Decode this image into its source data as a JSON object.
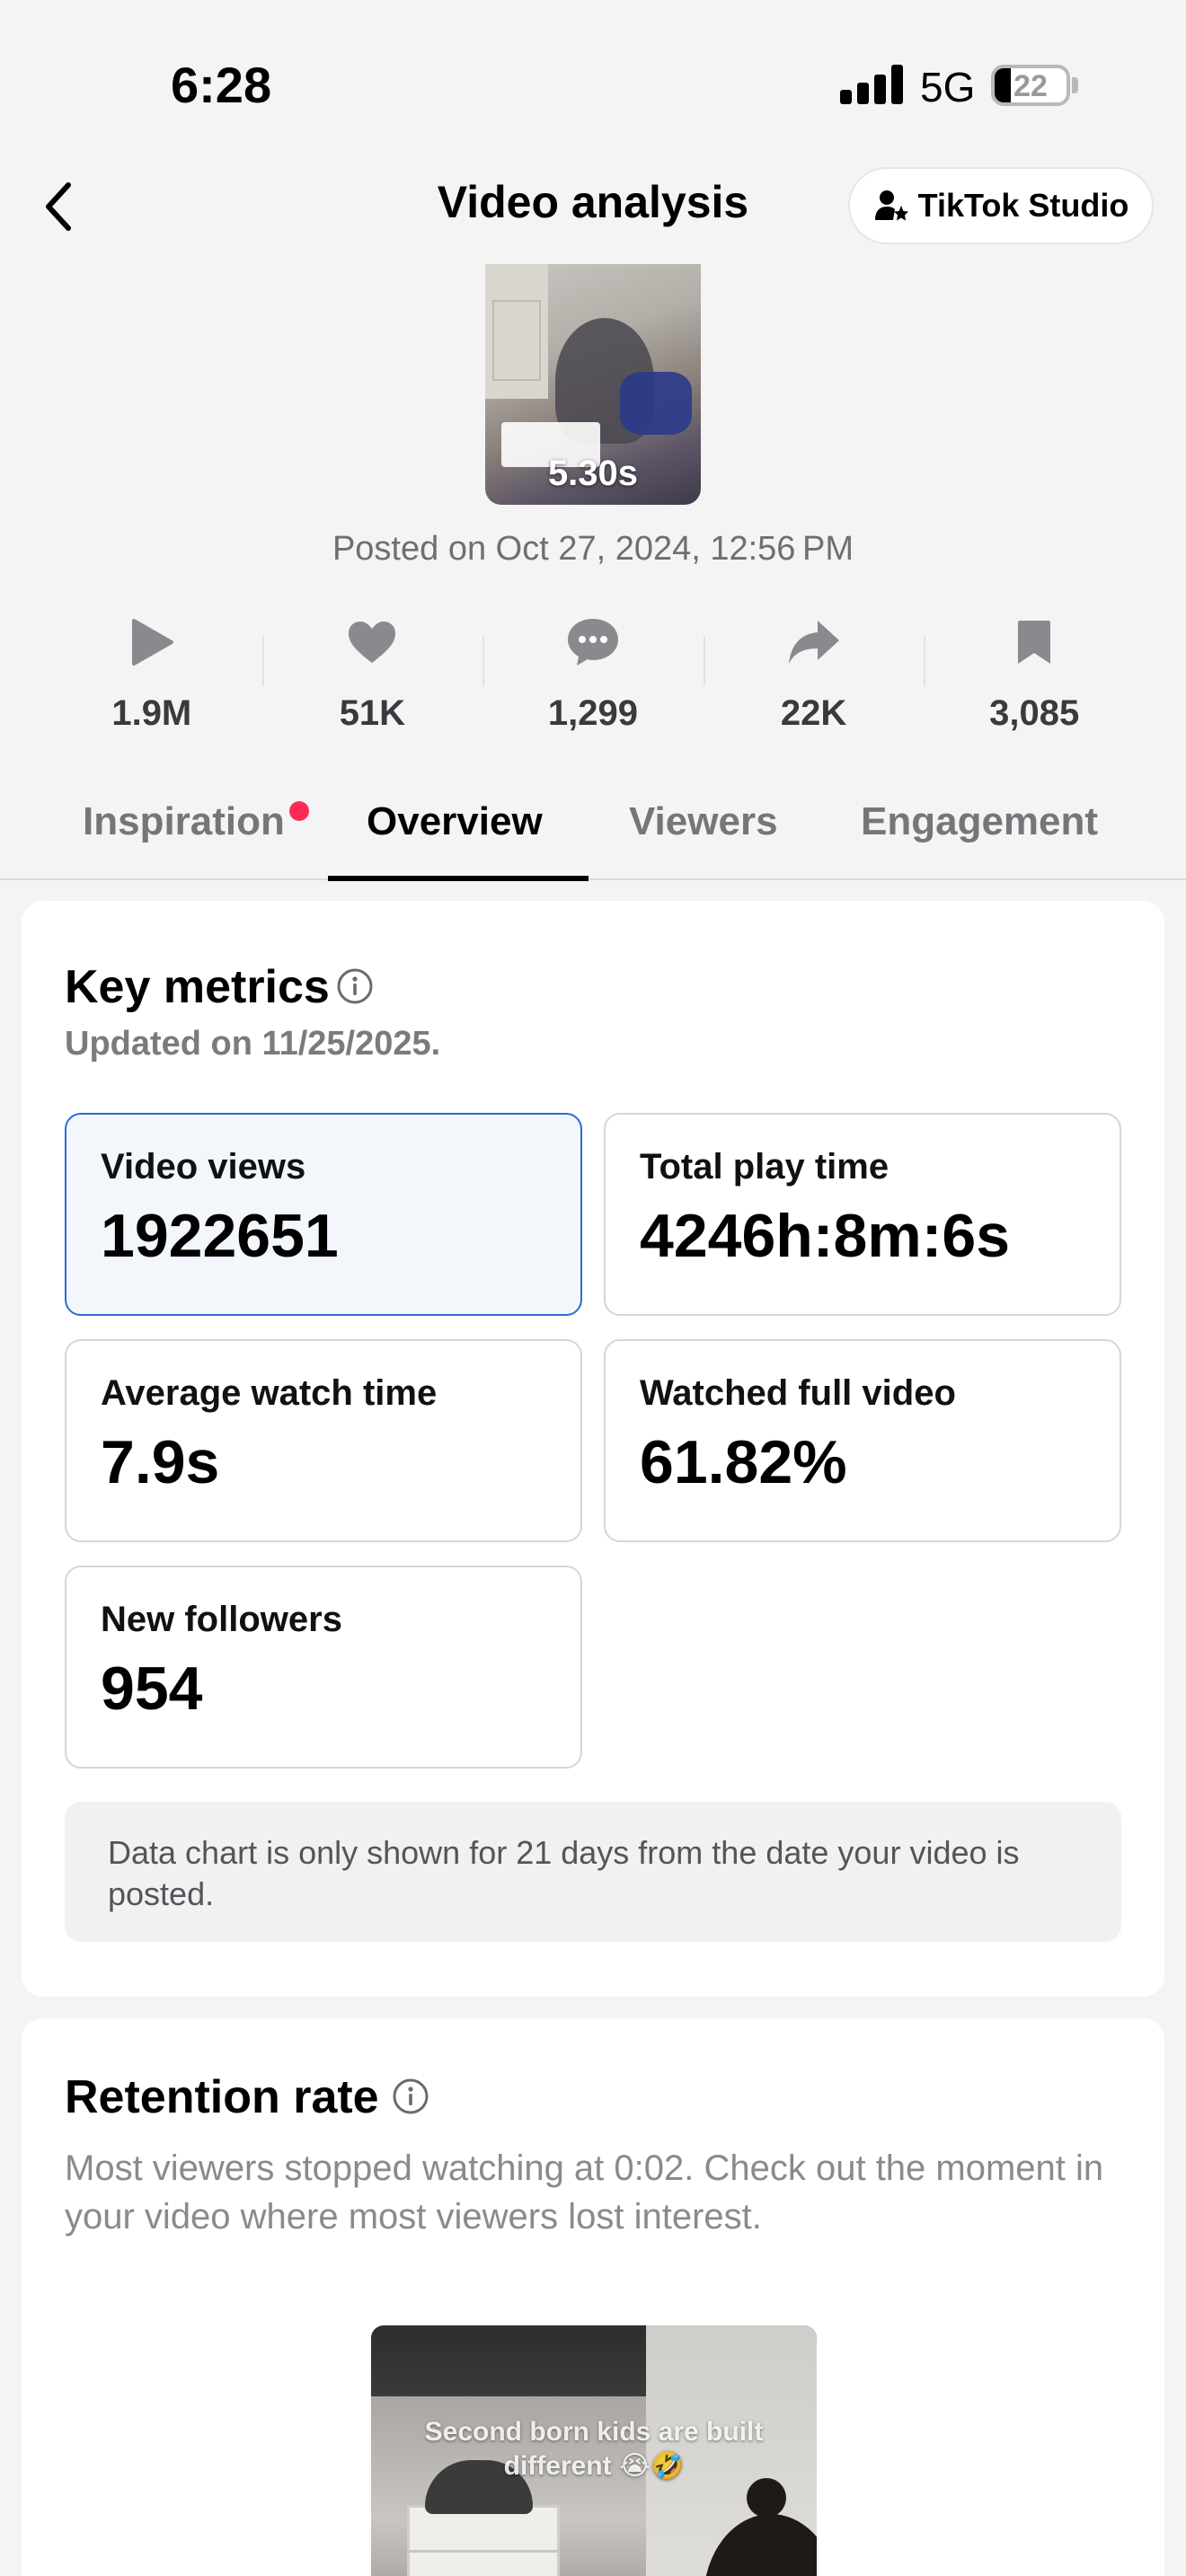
{
  "status_bar": {
    "time": "6:28",
    "network": "5G",
    "battery": "22",
    "battery_level_percent": 22
  },
  "header": {
    "title": "Video analysis",
    "studio_button": "TikTok Studio"
  },
  "video": {
    "duration": "5.30s",
    "posted": "Posted on Oct 27, 2024, 12:56 PM"
  },
  "stats": [
    {
      "icon": "play-icon",
      "value": "1.9M"
    },
    {
      "icon": "heart-icon",
      "value": "51K"
    },
    {
      "icon": "comment-icon",
      "value": "1,299"
    },
    {
      "icon": "share-icon",
      "value": "22K"
    },
    {
      "icon": "bookmark-icon",
      "value": "3,085"
    }
  ],
  "tabs": [
    {
      "label": "Inspiration",
      "has_dot": true
    },
    {
      "label": "Overview",
      "active": true
    },
    {
      "label": "Viewers"
    },
    {
      "label": "Engagement"
    }
  ],
  "key_metrics": {
    "title": "Key metrics",
    "updated": "Updated on 11/25/2025.",
    "metrics": [
      {
        "label": "Video views",
        "value": "1922651",
        "selected": true
      },
      {
        "label": "Total play time",
        "value": "4246h:8m:6s"
      },
      {
        "label": "Average watch time",
        "value": "7.9s"
      },
      {
        "label": "Watched full video",
        "value": "61.82%"
      },
      {
        "label": "New followers",
        "value": "954"
      }
    ],
    "note": "Data chart is only shown for 21 days from the date your video is posted."
  },
  "retention": {
    "title": "Retention rate",
    "description": "Most viewers stopped watching at 0:02. Check out the moment in your video where most viewers lost interest.",
    "video_caption": "Second born kids are built different 😭🤣"
  },
  "colors": {
    "accent_red": "#fe2c55",
    "selected_border": "#2b6bd6",
    "selected_bg": "#f3f7fc"
  }
}
